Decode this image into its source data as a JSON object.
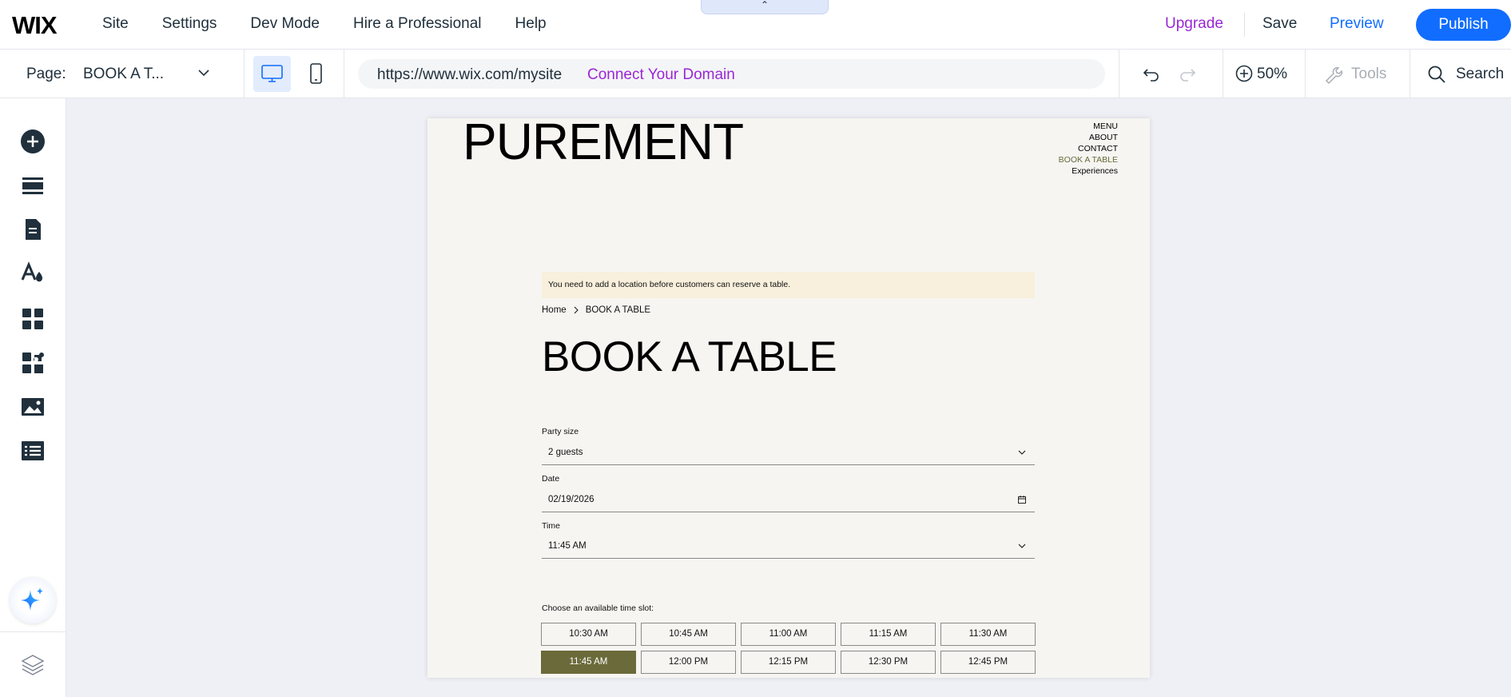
{
  "topbar": {
    "logo": "WIX",
    "nav": [
      "Site",
      "Settings",
      "Dev Mode",
      "Hire a Professional",
      "Help"
    ],
    "upgrade": "Upgrade",
    "save": "Save",
    "preview": "Preview",
    "publish": "Publish",
    "collapse_glyph": "⌃"
  },
  "subbar": {
    "page_label": "Page:",
    "page_name": "BOOK A T...",
    "url": "https://www.wix.com/mysite",
    "connect_domain": "Connect Your Domain",
    "zoom": "50%",
    "tools": "Tools",
    "search": "Search"
  },
  "sidebar": {
    "icons": [
      "add-elements-icon",
      "sections-icon",
      "pages-icon",
      "site-design-icon",
      "apps-icon",
      "business-apps-icon",
      "media-icon",
      "cms-icon",
      "ai-assistant-icon",
      "layers-icon"
    ]
  },
  "site": {
    "logo": "PUREMENT",
    "menu": [
      "MENU",
      "ABOUT",
      "CONTACT",
      "BOOK A TABLE",
      "Experiences"
    ],
    "notice": "You need to add a location before customers can reserve a table.",
    "breadcrumb": [
      "Home",
      "BOOK A TABLE"
    ],
    "title": "BOOK A TABLE",
    "party_size_label": "Party size",
    "party_size_value": "2 guests",
    "date_label": "Date",
    "date_value": "02/19/2026",
    "time_label": "Time",
    "time_value": "11:45 AM",
    "slots_label": "Choose an available time slot:",
    "slots_row1": [
      "10:30 AM",
      "10:45 AM",
      "11:00 AM",
      "11:15 AM",
      "11:30 AM"
    ],
    "slots_row2": [
      "11:45 AM",
      "12:00 PM",
      "12:15 PM",
      "12:30 PM",
      "12:45 PM"
    ],
    "selected_slot": "11:45 AM"
  },
  "colors": {
    "brand_blue": "#116dff",
    "upgrade_purple": "#9a27d5",
    "slot_selected": "#6b6a3a",
    "notice_bg": "#f8efdc"
  }
}
